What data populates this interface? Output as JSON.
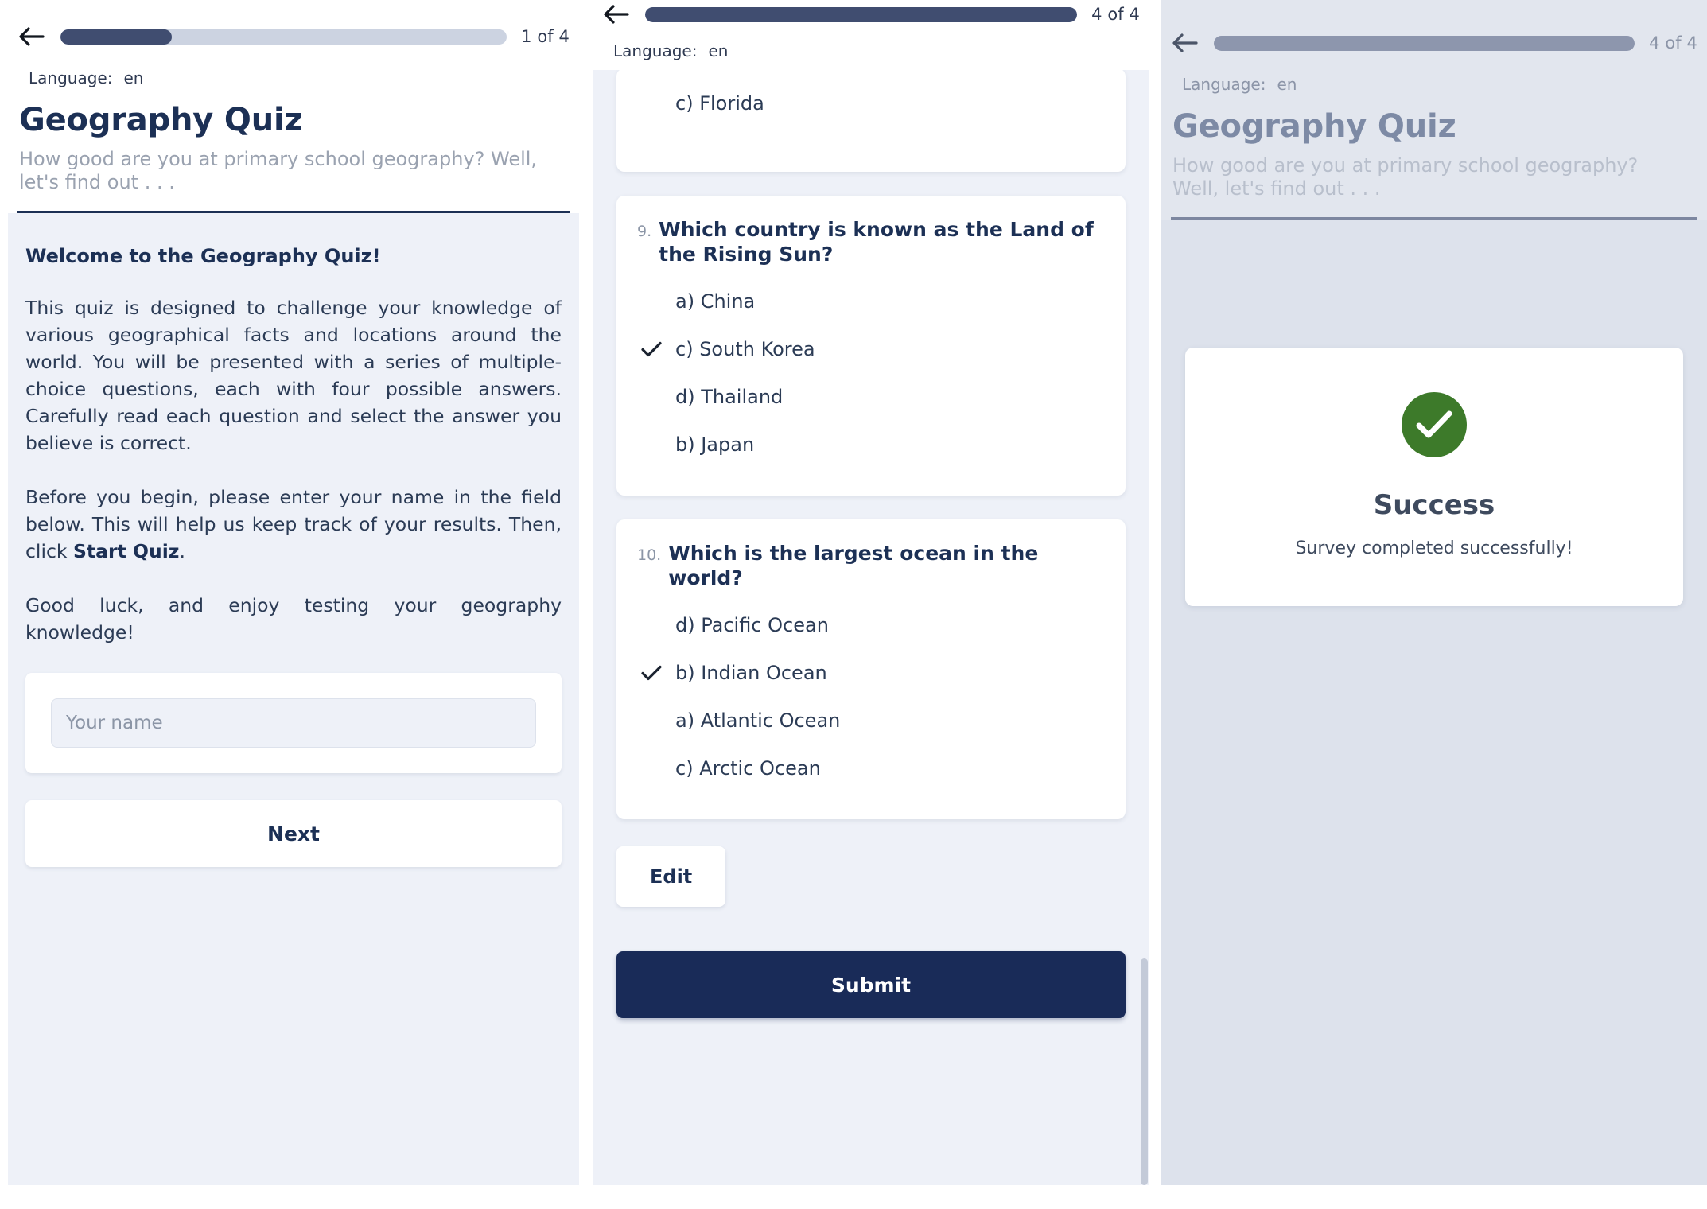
{
  "colors": {
    "accent_dark": "#192b58",
    "progress_fill": "#404d70",
    "progress_track": "#ccd3e1",
    "panel_bg": "#eef1f8",
    "success_green": "#3d7a2a",
    "title": "#1c3055"
  },
  "panels": [
    {
      "id": "welcome",
      "header": {
        "back_icon": "back-arrow-icon",
        "progress_percent": 25,
        "progress_label": "1 of 4",
        "language_label": "Language:",
        "language_value": "en",
        "title": "Geography Quiz",
        "description": "How good are you at primary school geography? Well, let's find out . . ."
      },
      "body": {
        "heading": "Welcome to the Geography Quiz!",
        "paragraph_1": "This quiz is designed to challenge your knowledge of various geographical facts and locations around the world. You will be presented with a series of multiple-choice questions, each with four possible answers. Carefully read each question and select the answer you believe is correct.",
        "paragraph_2_before": "Before you begin, please enter your name in the field below. This will help us keep track of your results. Then, click ",
        "paragraph_2_bold": "Start Quiz",
        "paragraph_2_after": ".",
        "paragraph_3": "Good luck, and enjoy testing your geography knowledge!",
        "name_input_value": "",
        "name_input_placeholder": "Your name",
        "next_button": "Next"
      }
    },
    {
      "id": "review",
      "header": {
        "back_icon": "back-arrow-icon",
        "progress_percent": 100,
        "progress_label": "4 of 4",
        "language_label": "Language:",
        "language_value": "en"
      },
      "clipped_question": {
        "visible_answer": "c) Florida"
      },
      "questions": [
        {
          "number": "9.",
          "text": "Which country is known as the Land of the Rising Sun?",
          "answers": [
            {
              "label": "a) China",
              "selected": false
            },
            {
              "label": "c) South Korea",
              "selected": true
            },
            {
              "label": "d) Thailand",
              "selected": false
            },
            {
              "label": "b) Japan",
              "selected": false
            }
          ]
        },
        {
          "number": "10.",
          "text": "Which is the largest ocean in the world?",
          "answers": [
            {
              "label": "d) Pacific Ocean",
              "selected": false
            },
            {
              "label": "b) Indian Ocean",
              "selected": true
            },
            {
              "label": "a) Atlantic Ocean",
              "selected": false
            },
            {
              "label": "c) Arctic Ocean",
              "selected": false
            }
          ]
        }
      ],
      "edit_button": "Edit",
      "submit_button": "Submit"
    },
    {
      "id": "success",
      "header": {
        "back_icon": "back-arrow-icon",
        "progress_percent": 100,
        "progress_label": "4 of 4",
        "language_label": "Language:",
        "language_value": "en",
        "title": "Geography Quiz",
        "description": "How good are you at primary school geography? Well, let's find out . . ."
      },
      "card": {
        "icon": "success-check-circle-icon",
        "title": "Success",
        "message": "Survey completed successfully!"
      }
    }
  ]
}
